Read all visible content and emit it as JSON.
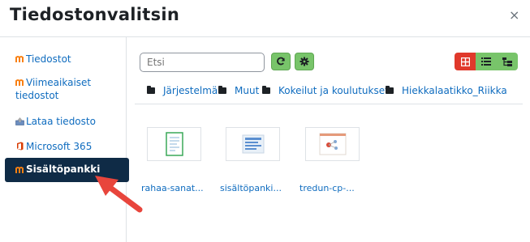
{
  "dialog": {
    "title": "Tiedostonvalitsin",
    "close_glyph": "×"
  },
  "sidebar": {
    "items": [
      {
        "label": "Tiedostot",
        "icon": "moodle-icon"
      },
      {
        "label": "Viimeaikaiset",
        "label2": "tiedostot",
        "icon": "moodle-icon"
      },
      {
        "label": "Lataa tiedosto",
        "icon": "upload-icon"
      },
      {
        "label": "Microsoft 365",
        "icon": "office-icon"
      },
      {
        "label": "Sisältöpankki",
        "icon": "moodle-icon",
        "active": true
      }
    ]
  },
  "toolbar": {
    "search_placeholder": "Etsi",
    "refresh_icon": "refresh-icon",
    "settings_icon": "gear-icon",
    "view_buttons": [
      "grid-view-icon",
      "list-view-icon",
      "tree-view-icon"
    ]
  },
  "breadcrumb": [
    "Järjestelmä",
    "Muut",
    "Kokeilut ja koulutukset",
    "Hiekkalaatikko_Riikka"
  ],
  "files": [
    {
      "name": "rahaa-sanat..."
    },
    {
      "name": "sisältöpanki..."
    },
    {
      "name": "tredun-cp-..."
    }
  ],
  "colors": {
    "accent": "#0f6cbf",
    "active_bg": "#0f2b46",
    "green": "#78c46a",
    "red": "#e0392b",
    "arrow": "#e8453c"
  }
}
